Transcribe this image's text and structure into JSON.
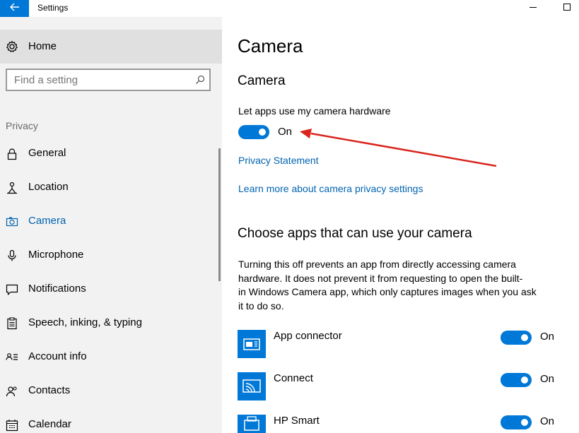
{
  "window": {
    "title": "Settings",
    "back_icon": "back-arrow-icon",
    "accent": "#0078d7"
  },
  "sidebar": {
    "home_label": "Home",
    "search_placeholder": "Find a setting",
    "section_label": "Privacy",
    "items": [
      {
        "label": "General",
        "icon": "lock-icon"
      },
      {
        "label": "Location",
        "icon": "location-icon"
      },
      {
        "label": "Camera",
        "icon": "camera-icon",
        "active": true
      },
      {
        "label": "Microphone",
        "icon": "microphone-icon"
      },
      {
        "label": "Notifications",
        "icon": "notifications-icon"
      },
      {
        "label": "Speech, inking, & typing",
        "icon": "speech-icon"
      },
      {
        "label": "Account info",
        "icon": "account-info-icon"
      },
      {
        "label": "Contacts",
        "icon": "contacts-icon"
      },
      {
        "label": "Calendar",
        "icon": "calendar-icon"
      }
    ]
  },
  "main": {
    "page_title": "Camera",
    "section1_title": "Camera",
    "camera_access_label": "Let apps use my camera hardware",
    "camera_access_state": "On",
    "privacy_link": "Privacy Statement",
    "learn_more_link": "Learn more about camera privacy settings",
    "section2_title": "Choose apps that can use your camera",
    "section2_desc_lines": [
      "Turning this off prevents an app from directly accessing camera",
      "hardware. It does not prevent it from requesting to open the built-",
      "in Windows Camera app, which only captures images when you ask",
      "it to do so."
    ],
    "apps": [
      {
        "name": "App connector",
        "state": "On"
      },
      {
        "name": "Connect",
        "state": "On"
      },
      {
        "name": "HP Smart",
        "state": "On"
      }
    ]
  },
  "annotation": {
    "arrow_color": "#d9251d"
  }
}
